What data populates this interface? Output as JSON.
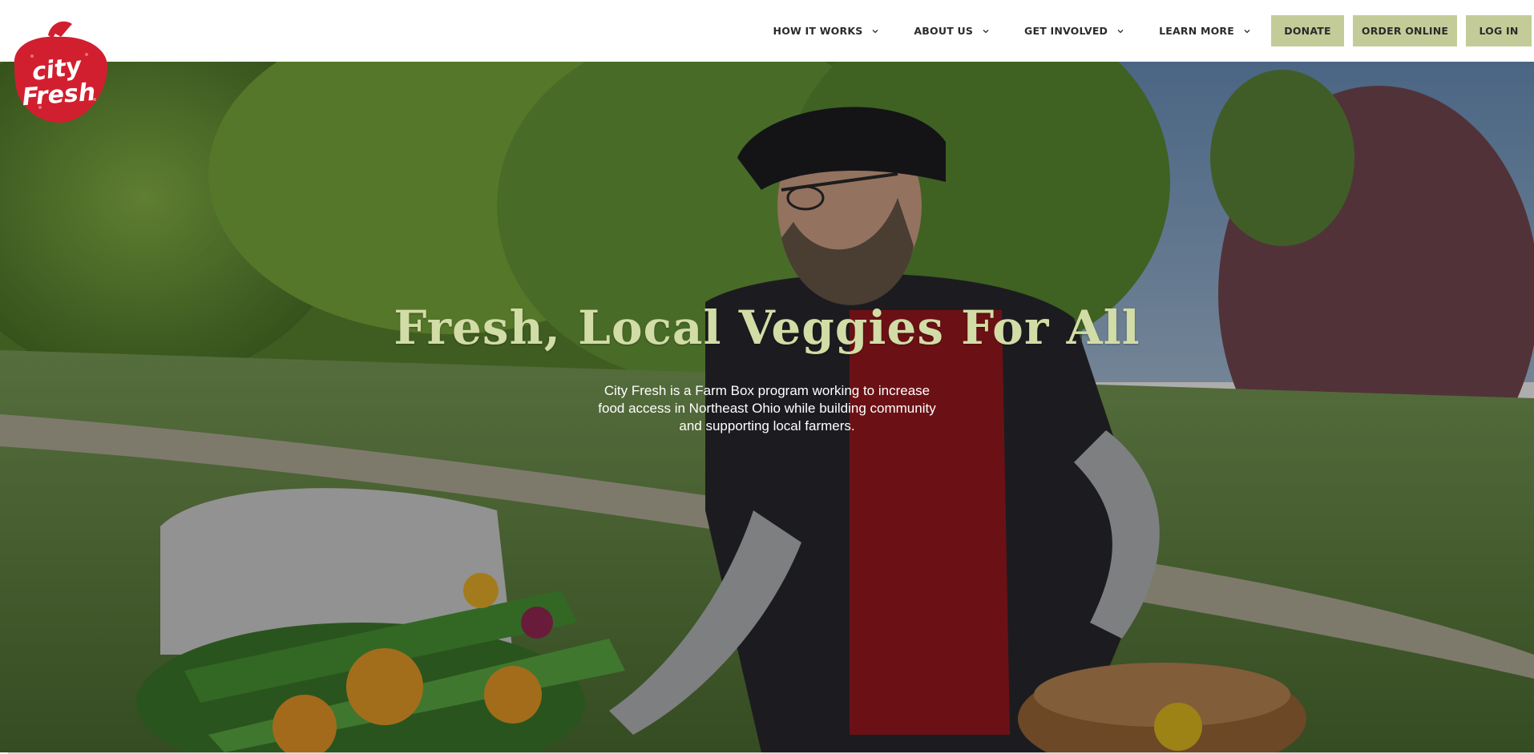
{
  "brand": {
    "logo_line1": "city",
    "logo_line2": "Fresh",
    "logo_color": "#d21f2f"
  },
  "nav": {
    "items": [
      {
        "label": "HOW IT WORKS",
        "icon": "chevron-down-icon"
      },
      {
        "label": "ABOUT US",
        "icon": "chevron-down-icon"
      },
      {
        "label": "GET INVOLVED",
        "icon": "chevron-down-icon"
      },
      {
        "label": "LEARN MORE",
        "icon": "chevron-down-icon"
      }
    ],
    "buttons": {
      "donate": "DONATE",
      "order_online": "ORDER ONLINE",
      "log_in": "LOG IN"
    },
    "button_color": "#c3cc98"
  },
  "hero": {
    "title": "Fresh, Local Veggies For All",
    "subtitle": "City Fresh is a Farm Box program working to increase food access in Northeast Ohio while building community and supporting local farmers.",
    "title_color": "#d2dca6"
  }
}
